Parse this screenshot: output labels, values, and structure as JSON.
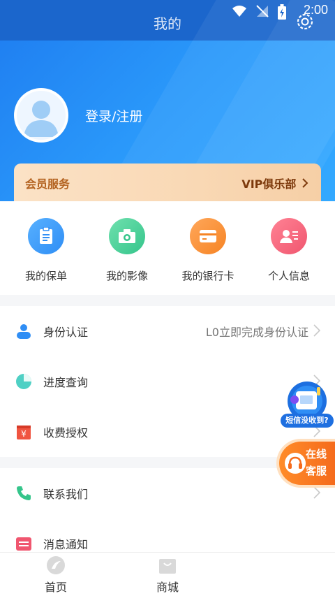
{
  "status_bar": {
    "time": "2:00"
  },
  "header": {
    "title": "我的"
  },
  "profile": {
    "login_label": "登录/注册"
  },
  "vip": {
    "left_label": "会员服务",
    "right_label": "VIP俱乐部"
  },
  "quick_actions": [
    {
      "label": "我的保单",
      "icon": "policy-icon",
      "color": "#2f8ef5"
    },
    {
      "label": "我的影像",
      "icon": "camera-icon",
      "color": "#35c58b"
    },
    {
      "label": "我的银行卡",
      "icon": "bank-card-icon",
      "color": "#f68424"
    },
    {
      "label": "个人信息",
      "icon": "person-info-icon",
      "color": "#f0566f"
    }
  ],
  "menu": [
    {
      "label": "身份认证",
      "hint": "L0立即完成身份认证",
      "icon": "identity-icon"
    },
    {
      "label": "进度查询",
      "hint": "",
      "icon": "progress-icon"
    },
    {
      "label": "收费授权",
      "hint": "",
      "icon": "fee-auth-icon"
    },
    {
      "label": "联系我们",
      "hint": "",
      "icon": "phone-icon"
    },
    {
      "label": "消息通知",
      "hint": "",
      "icon": "message-icon"
    }
  ],
  "floating": {
    "sms_label": "短信没收到?",
    "service_line1": "在线",
    "service_line2": "客服"
  },
  "tabbar": {
    "tabs": [
      {
        "label": "首页",
        "icon": "home-logo-icon"
      },
      {
        "label": "商城",
        "icon": "shop-bag-icon"
      }
    ]
  }
}
